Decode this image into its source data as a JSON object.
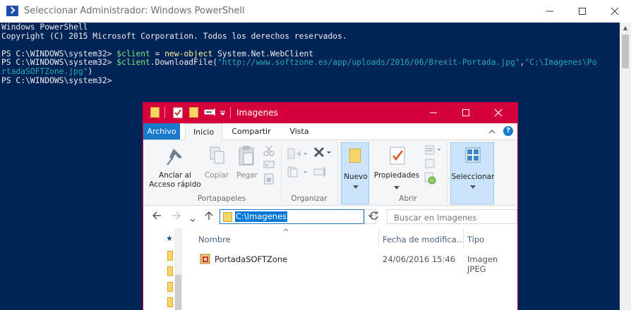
{
  "powershell": {
    "title": "Seleccionar Administrador: Windows PowerShell",
    "lines": {
      "l1": "Windows PowerShell",
      "l2": "Copyright (C) 2015 Microsoft Corporation. Todos los derechos reservados.",
      "prompt": "PS C:\\WINDOWS\\system32> ",
      "l4_var": "$client",
      "l4_eq": " = ",
      "l4_cmd": "new-object",
      "l4_rest": " System.Net.WebClient",
      "l5_var": "$client",
      "l5_method": ".DownloadFile(",
      "l5_url": "\"http://www.softzone.es/app/uploads/2016/06/Brexit-Portada.jpg\"",
      "l5_comma": ",",
      "l5_dest_a": "\"C:\\Imagenes\\Po",
      "l6_dest_b": "rtadaSOFTZone.jpg\"",
      "l6_close": ")"
    }
  },
  "explorer": {
    "title": "Imagenes",
    "tabs": {
      "archivo": "Archivo",
      "inicio": "Inicio",
      "compartir": "Compartir",
      "vista": "Vista"
    },
    "ribbon": {
      "anclar": "Anclar al",
      "acceso": "Acceso rápido",
      "copiar": "Copiar",
      "pegar": "Pegar",
      "portapapeles": "Portapapeles",
      "organizar": "Organizar",
      "nuevo": "Nuevo",
      "propiedades": "Propiedades",
      "abrir": "Abrir",
      "seleccionar": "Seleccionar"
    },
    "address": "C:\\Imagenes",
    "search_placeholder": "Buscar en Imagenes",
    "columns": {
      "nombre": "Nombre",
      "fecha": "Fecha de modifica...",
      "tipo": "Tipo"
    },
    "file": {
      "name": "PortadaSOFTZone",
      "date": "24/06/2016 15:46",
      "type": "Imagen JPEG"
    }
  },
  "colors": {
    "ps_background": "#012456",
    "explorer_accent": "#d4003c",
    "file_tab": "#1979ca"
  }
}
